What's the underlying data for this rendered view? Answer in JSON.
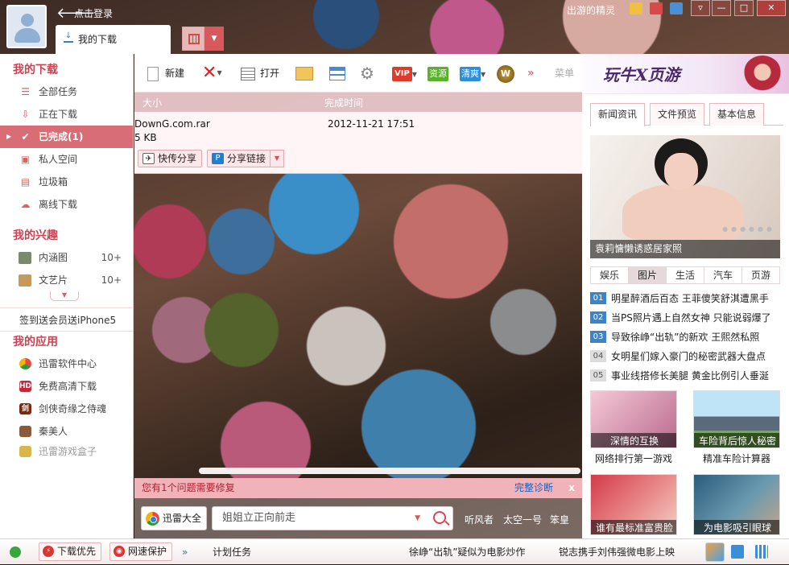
{
  "header": {
    "login_text": "点击登录",
    "active_tab": "我的下载",
    "skin_name": "出游的精灵",
    "win_buttons": [
      "▿",
      "—",
      "□",
      "✕"
    ]
  },
  "sidebar": {
    "my_downloads_title": "我的下载",
    "download_items": [
      {
        "label": "全部任务",
        "icon": "list-icon"
      },
      {
        "label": "正在下载",
        "icon": "down-arrow-icon"
      },
      {
        "label": "已完成(1)",
        "icon": "check-icon"
      },
      {
        "label": "私人空间",
        "icon": "lock-icon"
      },
      {
        "label": "垃圾箱",
        "icon": "trash-icon"
      },
      {
        "label": "离线下载",
        "icon": "cloud-download-icon"
      }
    ],
    "interests_title": "我的兴趣",
    "interests": [
      {
        "label": "内涵图",
        "count": "10+"
      },
      {
        "label": "文艺片",
        "count": "10+"
      }
    ],
    "promo": "签到送会员送iPhone5",
    "apps_title": "我的应用",
    "apps": [
      {
        "label": "迅雷软件中心",
        "badge": ""
      },
      {
        "label": "免费高清下载",
        "badge": "HD"
      },
      {
        "label": "剑侠奇缘之侍魂",
        "badge": "剑"
      },
      {
        "label": "秦美人",
        "badge": ""
      },
      {
        "label": "迅雷游戏盒子",
        "badge": ""
      }
    ]
  },
  "toolbar": {
    "new_label": "新建",
    "open_label": "打开",
    "vip_badge": "VIP",
    "res_badge": "资源",
    "clean_badge": "清爽",
    "more": "»",
    "menu_label": "菜单"
  },
  "list": {
    "col_size": "大小",
    "col_finish_time": "完成时间",
    "file_name": "DownG.com.rar",
    "file_size": "5 KB",
    "finish_time": "2012-11-21 17:51",
    "share_fast": "快传分享",
    "share_link": "分享链接"
  },
  "issue_bar": {
    "message": "您有1个问题需要修复",
    "fix_link": "完整诊断",
    "close": "x"
  },
  "search": {
    "xunlei_all": "迅雷大全",
    "query": "姐姐立正向前走",
    "hot": [
      "听风者",
      "太空一号",
      "笨皇"
    ]
  },
  "right_panel": {
    "logo": "玩牛X页游",
    "tabs": [
      "新闻资讯",
      "文件预览",
      "基本信息"
    ],
    "photo_caption": "袁莉慵懒诱惑居家照",
    "categories": [
      "娱乐",
      "图片",
      "生活",
      "汽车",
      "页游"
    ],
    "active_category": "图片",
    "news": [
      {
        "n": "01",
        "text": "明星醉酒后百态 王菲傻笑舒淇遭黑手"
      },
      {
        "n": "02",
        "text": "当PS照片遇上自然女神 只能说弱爆了"
      },
      {
        "n": "03",
        "text": "导致徐峥“出轨”的新欢 王熙然私照"
      },
      {
        "n": "04",
        "text": "女明星们嫁入豪门的秘密武器大盘点"
      },
      {
        "n": "05",
        "text": "事业线搭修长美腿 黄金比例引人垂涎"
      }
    ],
    "tiles": [
      {
        "caption": "深情的互换",
        "label": "网络排行第一游戏"
      },
      {
        "caption": "车险背后惊人秘密",
        "label": "精准车险计算器"
      },
      {
        "caption": "谁有最标准富贵脸",
        "label": ""
      },
      {
        "caption": "为电影吸引眼球",
        "label": ""
      }
    ]
  },
  "statusbar": {
    "priority": "下载优先",
    "protect": "网速保护",
    "more": "»",
    "schedule": "计划任务",
    "ticker1": "徐峥“出轨”疑似为电影炒作",
    "ticker2": "锐志携手刘伟强微电影上映"
  }
}
